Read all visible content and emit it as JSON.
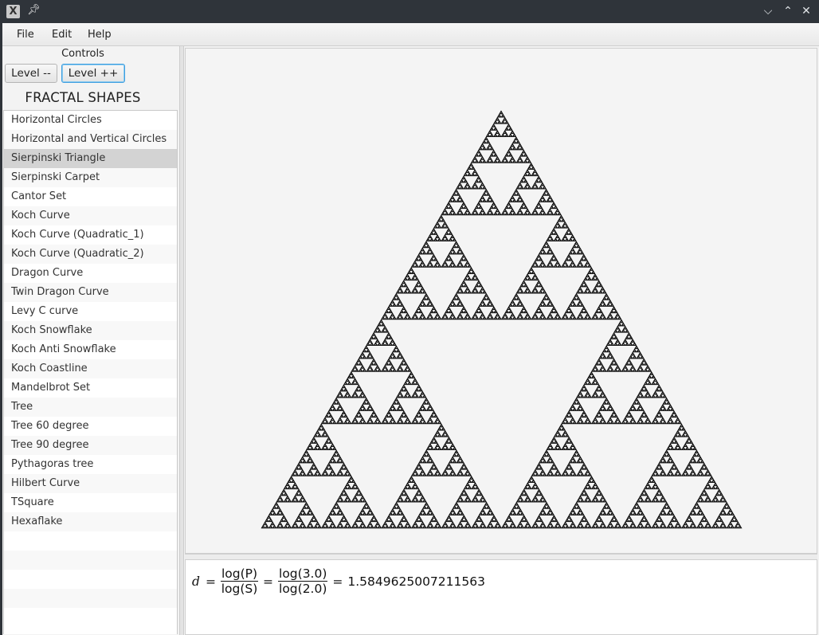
{
  "titlebar": {
    "app_icon": "x-app-icon",
    "pin_icon": "pin-icon",
    "controls": [
      "minimize",
      "maximize",
      "close"
    ]
  },
  "menubar": {
    "items": [
      "File",
      "Edit",
      "Help"
    ]
  },
  "controls": {
    "label": "Controls",
    "level_down": "Level --",
    "level_up": "Level ++"
  },
  "shapes": {
    "title": "FRACTAL SHAPES",
    "selected": "Sierpinski Triangle",
    "items": [
      "Horizontal Circles",
      "Horizontal and Vertical Circles",
      "Sierpinski Triangle",
      "Sierpinski Carpet",
      "Cantor Set",
      "Koch Curve",
      "Koch Curve (Quadratic_1)",
      "Koch Curve (Quadratic_2)",
      "Dragon Curve",
      "Twin Dragon Curve",
      "Levy C curve",
      "Koch Snowflake",
      "Koch Anti Snowflake",
      "Koch Coastline",
      "Mandelbrot Set",
      "Tree",
      "Tree 60 degree",
      "Tree 90 degree",
      "Pythagoras tree",
      "Hilbert Curve",
      "TSquare",
      "Hexaflake"
    ]
  },
  "fractal": {
    "shape": "Sierpinski Triangle",
    "level": 8,
    "fill_color": "#111111",
    "background": "#f4f4f4"
  },
  "formula": {
    "var": "d",
    "eq": "=",
    "num1": "log(P)",
    "den1": "log(S)",
    "num2": "log(3.0)",
    "den2": "log(2.0)",
    "result": "1.5849625007211563"
  }
}
